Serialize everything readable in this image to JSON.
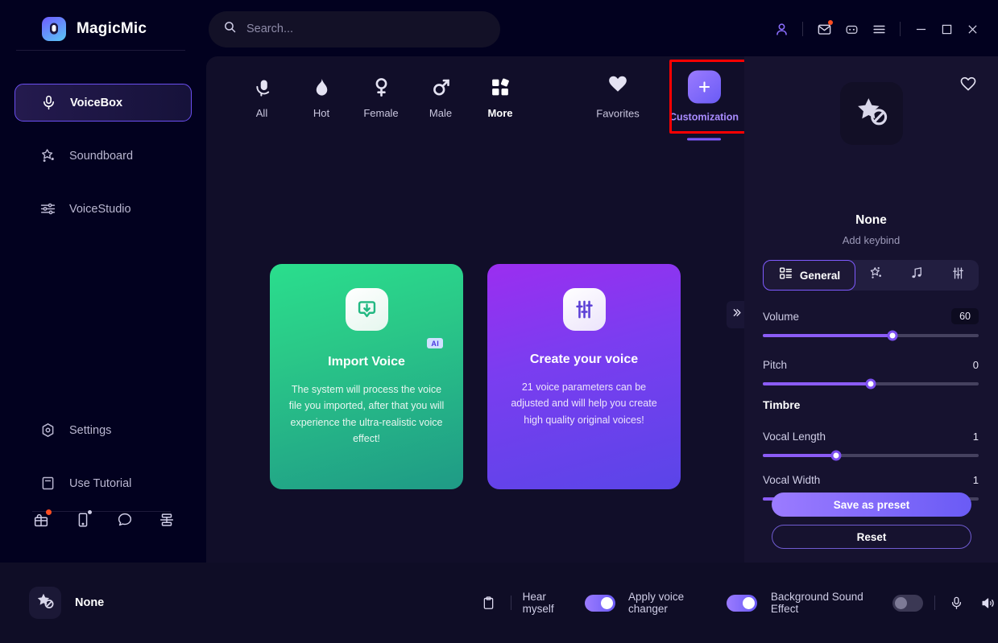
{
  "app": {
    "brand_name": "MagicMic",
    "brand_logo_icon": "magicmic-logo-icon"
  },
  "search": {
    "placeholder": "Search...",
    "value": "",
    "icon": "search-icon"
  },
  "titlebar": {
    "account_icon": "user-account-icon",
    "mail_icon": "mail-envelope-icon",
    "discord_icon": "discord-icon",
    "menu_icon": "hamburger-menu-icon",
    "minimize_icon": "minimize-icon",
    "maximize_icon": "maximize-icon",
    "close_icon": "close-icon"
  },
  "sidebar": {
    "items": [
      {
        "label": "VoiceBox",
        "icon": "microphone-icon",
        "active": true
      },
      {
        "label": "Soundboard",
        "icon": "magic-wand-icon",
        "active": false
      },
      {
        "label": "VoiceStudio",
        "icon": "sliders-icon",
        "active": false
      }
    ],
    "lower_items": [
      {
        "label": "Settings",
        "icon": "gear-icon"
      },
      {
        "label": "Use Tutorial",
        "icon": "book-icon"
      }
    ],
    "bottom_icons": [
      {
        "name": "gift-box-icon",
        "badge": true
      },
      {
        "name": "mobile-device-icon",
        "badge_small": true
      },
      {
        "name": "chat-bubble-icon",
        "badge": false
      },
      {
        "name": "network-share-icon",
        "badge": false
      }
    ]
  },
  "main": {
    "tabs": [
      {
        "label": "All",
        "icon": "microphone-tab-icon",
        "bold": false
      },
      {
        "label": "Hot",
        "icon": "flame-icon",
        "bold": false
      },
      {
        "label": "Female",
        "icon": "female-symbol-icon",
        "bold": false
      },
      {
        "label": "Male",
        "icon": "male-symbol-icon",
        "bold": false
      },
      {
        "label": "More",
        "icon": "grid-squares-icon",
        "bold": true
      }
    ],
    "favorites_tab": {
      "label": "Favorites",
      "icon": "heart-icon"
    },
    "customization_tab": {
      "label": "Customization",
      "icon": "plus-icon",
      "selected": true,
      "highlight_color": "#ff0000"
    },
    "collapse_icon": "chevron-double-right-icon",
    "cards": [
      {
        "title": "Import Voice",
        "description": "The system will process the voice file you imported, after that you will experience the ultra-realistic voice effect!",
        "icon": "import-download-icon",
        "badge": "AI",
        "accent": "#2ade8d"
      },
      {
        "title": "Create your voice",
        "description": "21 voice parameters can be adjusted and will help you create high quality original voices!",
        "icon": "equalizer-sliders-icon",
        "badge": "",
        "accent": "#9b2ef0"
      }
    ]
  },
  "right_panel": {
    "favorite_icon": "heart-outline-icon",
    "avatar_icon": "star-none-icon",
    "voice_name": "None",
    "keybind_label": "Add keybind",
    "segments": [
      {
        "label": "General",
        "icon": "grid-list-icon",
        "active": true
      },
      {
        "label": "",
        "icon": "magic-wand-icon",
        "active": false
      },
      {
        "label": "",
        "icon": "music-note-icon",
        "active": false
      },
      {
        "label": "",
        "icon": "equalizer-icon",
        "active": false
      }
    ],
    "sliders": [
      {
        "label": "Volume",
        "value": "60",
        "percent": 60,
        "boxed": true
      },
      {
        "label": "Pitch",
        "value": "0",
        "percent": 50,
        "boxed": false
      }
    ],
    "timbre_title": "Timbre",
    "timbre_sliders": [
      {
        "label": "Vocal Length",
        "value": "1",
        "percent": 34,
        "boxed": false
      },
      {
        "label": "Vocal Width",
        "value": "1",
        "percent": 34,
        "boxed": false
      }
    ],
    "save_label": "Save as preset",
    "reset_label": "Reset"
  },
  "bottom_bar": {
    "voice_name": "None",
    "voice_avatar_icon": "star-none-icon",
    "clipboard_icon": "clipboard-icon",
    "hear_myself": {
      "label": "Hear myself",
      "on": true
    },
    "apply_voice_changer": {
      "label": "Apply voice changer",
      "on": true
    },
    "background_sound_effect": {
      "label": "Background Sound Effect",
      "on": false
    },
    "mic_icon": "microphone-icon",
    "speaker_icon": "speaker-volume-icon"
  },
  "colors": {
    "accent_purple": "#7f5bff",
    "highlight_red": "#ff0000",
    "bg_app": "#02011f",
    "bg_main": "#110e29",
    "bg_right": "#16122f",
    "bg_bottom": "#0f0d26"
  }
}
